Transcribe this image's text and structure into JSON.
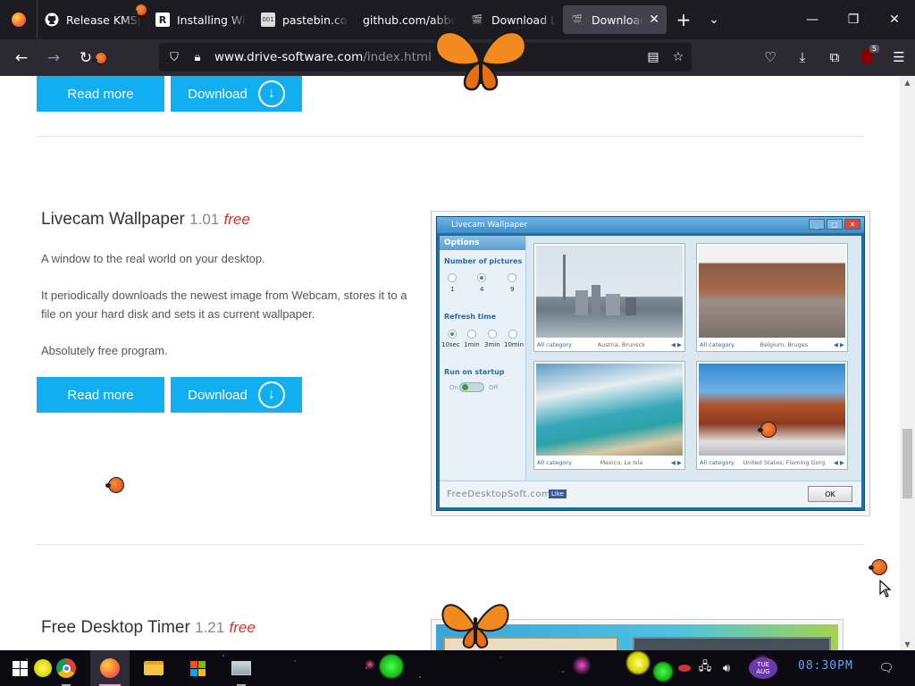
{
  "browser": {
    "tabs": [
      {
        "label": "Release KMSp",
        "icon": "github-icon"
      },
      {
        "label": "Installing Wind",
        "icon": "r-icon"
      },
      {
        "label": "pastebin.com/",
        "icon": "pastebin-icon"
      },
      {
        "label": "github.com/abbod",
        "icon": "none"
      },
      {
        "label": "Download Lad",
        "icon": "clapper-icon"
      },
      {
        "label": "Download A",
        "icon": "clapper-icon",
        "active": true
      }
    ],
    "url_host": "www.drive-software.com",
    "url_path": "/index.html",
    "extension_badge": "5"
  },
  "page": {
    "buttons": {
      "read_more": "Read more",
      "download": "Download"
    },
    "products": [
      {
        "name": "Livecam Wallpaper",
        "version": "1.01",
        "price": "free",
        "paragraphs": [
          "A window to the real world on your desktop.",
          "It periodically downloads the newest image from Webcam, stores it to a file on your hard disk and sets it as current wallpaper.",
          "Absolutely free program."
        ]
      },
      {
        "name": "Free Desktop Timer",
        "version": "1.21",
        "price": "free"
      }
    ],
    "screenshot": {
      "window_title": "Livecam Wallpaper",
      "options_title": "Options",
      "number_label": "Number of pictures",
      "number_options": [
        "1",
        "4",
        "9"
      ],
      "refresh_label": "Refresh time",
      "refresh_options": [
        "10sec",
        "1min",
        "3min",
        "10min"
      ],
      "startup_label": "Run on startup",
      "toggle_on": "On",
      "toggle_off": "Off",
      "cams": [
        {
          "category": "All category",
          "location": "Austria, Brunsck"
        },
        {
          "category": "All category",
          "location": "Belgium, Bruges"
        },
        {
          "category": "All category",
          "location": "Mexico, La Isla"
        },
        {
          "category": "All category",
          "location": "United States, Flaming Gorg"
        }
      ],
      "footer_brand": "FreeDesktopSoft.com",
      "like": "Like",
      "ok": "OK"
    }
  },
  "taskbar": {
    "day": "TUE",
    "month": "AUG",
    "time": "08:30PM"
  }
}
